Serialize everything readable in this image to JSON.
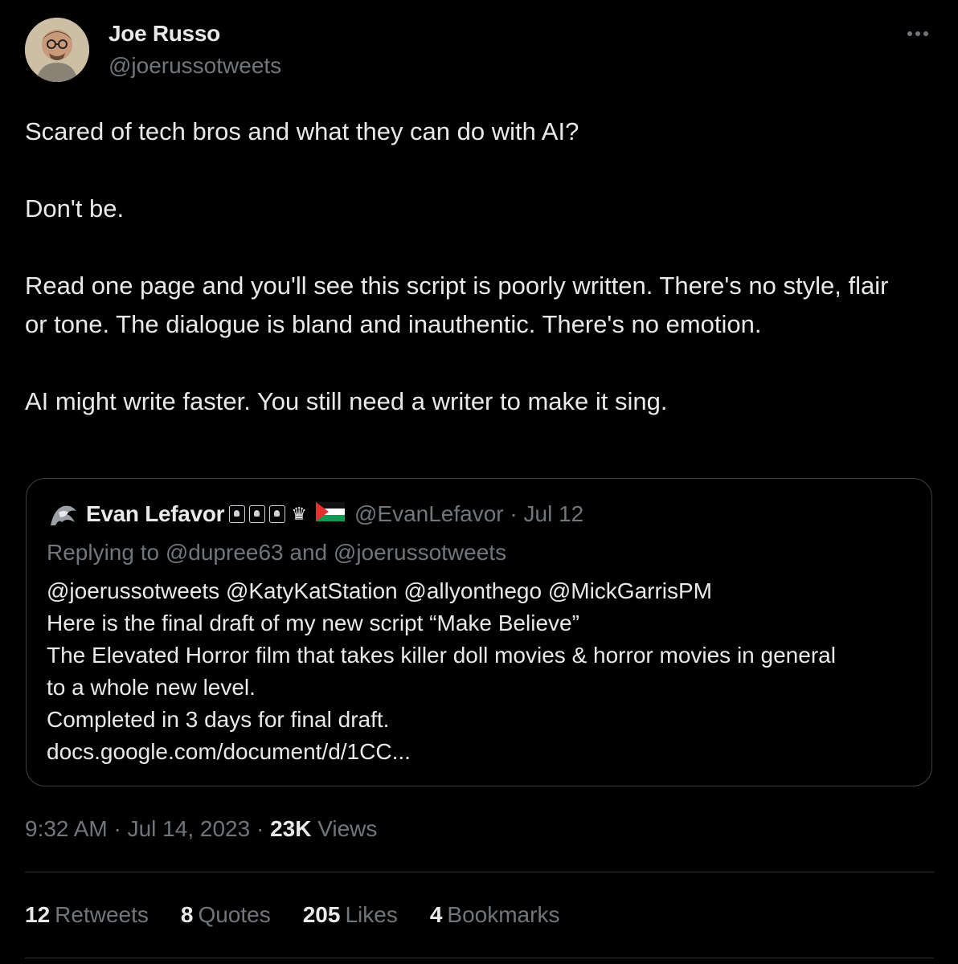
{
  "author": {
    "name": "Joe Russo",
    "handle": "@joerussotweets"
  },
  "tweet": {
    "paragraphs": [
      "Scared of tech bros and what they can do with AI?",
      "Don't be.",
      "Read one page and you'll see this script is poorly written. There's no style, flair or tone. The dialogue is bland and inauthentic. There's no emotion.",
      "AI might write faster. You still need a writer to make it sing."
    ]
  },
  "quote": {
    "name": "Evan Lefavor",
    "crown": "♛",
    "handle_date": "@EvanLefavor · Jul 12",
    "replying_to": "Replying to @dupree63 and @joerussotweets",
    "lines": [
      "@joerussotweets @KatyKatStation @allyonthego @MickGarrisPM",
      "Here is the final draft of my new script “Make Believe”",
      "The Elevated Horror film that takes killer doll movies & horror movies in general",
      "to a whole new level.",
      "Completed in 3 days for final draft.",
      "docs.google.com/document/d/1CC..."
    ]
  },
  "meta": {
    "time_date": "9:32 AM · Jul 14, 2023 · ",
    "views_count": "23K",
    "views_label": " Views"
  },
  "stats": {
    "retweets_count": "12",
    "retweets_label": "Retweets",
    "quotes_count": "8",
    "quotes_label": "Quotes",
    "likes_count": "205",
    "likes_label": "Likes",
    "bookmarks_count": "4",
    "bookmarks_label": "Bookmarks"
  },
  "colors": {
    "background": "#000000",
    "text_primary": "#e7e9ea",
    "text_secondary": "#71767b",
    "border": "#2f3336"
  },
  "icons": {
    "more": "more-horizontal-icon"
  }
}
